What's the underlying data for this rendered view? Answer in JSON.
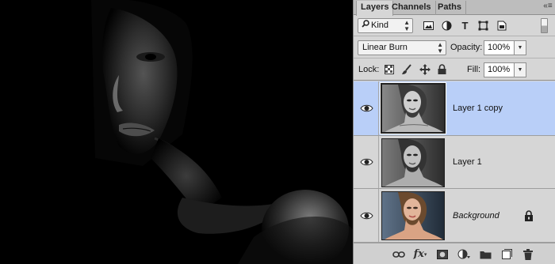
{
  "panel": {
    "tabs": [
      {
        "label": "Layers",
        "active": true
      },
      {
        "label": "Channels",
        "active": false
      },
      {
        "label": "Paths",
        "active": false
      }
    ],
    "menu_icon": "panel-menu-icon"
  },
  "filter": {
    "kind_label": "Kind",
    "filter_icons": [
      "image-filter-icon",
      "adjustment-filter-icon",
      "type-filter-icon",
      "shape-filter-icon",
      "smart-object-filter-icon"
    ]
  },
  "blend": {
    "mode": "Linear Burn",
    "opacity_label": "Opacity:",
    "opacity_value": "100%"
  },
  "lock": {
    "lock_label": "Lock:",
    "fill_label": "Fill:",
    "fill_value": "100%"
  },
  "layers": [
    {
      "name": "Layer 1 copy",
      "selected": true,
      "visible": true,
      "locked": false
    },
    {
      "name": "Layer 1",
      "selected": false,
      "visible": true,
      "locked": false
    },
    {
      "name": "Background",
      "selected": false,
      "visible": true,
      "locked": true,
      "italic": true
    }
  ],
  "footer_icons": [
    "link-layers-icon",
    "fx-icon",
    "add-mask-icon",
    "adjustment-layer-icon",
    "new-group-icon",
    "new-layer-icon",
    "delete-layer-icon"
  ],
  "footer_fx_label": "fx",
  "colors": {
    "panel_bg": "#d6d6d6",
    "selected_layer": "#b9cff8",
    "canvas_bg": "#000000"
  }
}
